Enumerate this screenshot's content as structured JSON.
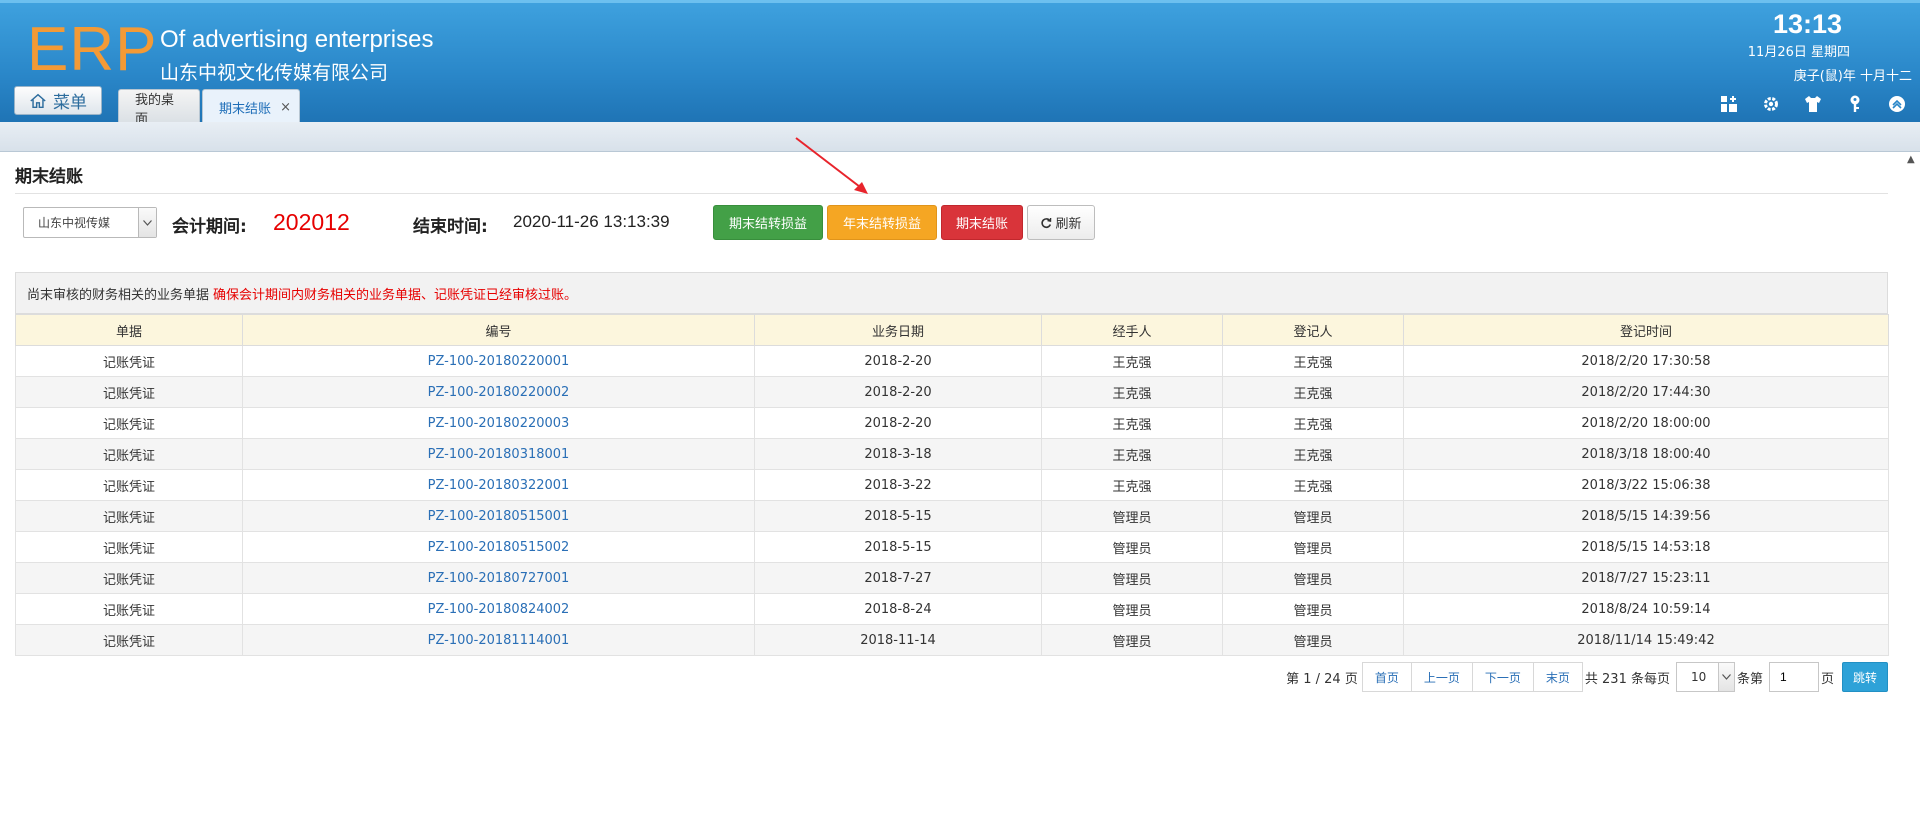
{
  "header": {
    "logo": "ERP",
    "brand_en": "Of advertising enterprises",
    "brand_cn": "山东中视文化传媒有限公司",
    "clock": "13:13",
    "date": "11月26日 星期四",
    "lunar": "庚子(鼠)年 十月十二",
    "menu_label": "菜单",
    "tabs": [
      {
        "label": "我的桌面"
      },
      {
        "label": "期末结账",
        "close": "×"
      }
    ],
    "tool_icons": [
      "add-widget-icon",
      "gear-icon",
      "shirt-icon",
      "key-icon",
      "collapse-icon"
    ]
  },
  "page": {
    "title": "期末结账",
    "company": "山东中视传媒",
    "period_label": "会计期间:",
    "period_value": "202012",
    "end_label": "结束时间:",
    "end_value": "2020-11-26 13:13:39",
    "buttons": {
      "period_transfer": "期末结转损益",
      "year_transfer": "年末结转损益",
      "close_period": "期末结账",
      "refresh": "刷新"
    },
    "notice_text": "尚末审核的财务相关的业务单据",
    "notice_warning": "确保会计期间内财务相关的业务单据、记账凭证已经审核过账。"
  },
  "table": {
    "headers": [
      "单据",
      "编号",
      "业务日期",
      "经手人",
      "登记人",
      "登记时间"
    ],
    "rows": [
      [
        "记账凭证",
        "PZ-100-20180220001",
        "2018-2-20",
        "王克强",
        "王克强",
        "2018/2/20 17:30:58"
      ],
      [
        "记账凭证",
        "PZ-100-20180220002",
        "2018-2-20",
        "王克强",
        "王克强",
        "2018/2/20 17:44:30"
      ],
      [
        "记账凭证",
        "PZ-100-20180220003",
        "2018-2-20",
        "王克强",
        "王克强",
        "2018/2/20 18:00:00"
      ],
      [
        "记账凭证",
        "PZ-100-20180318001",
        "2018-3-18",
        "王克强",
        "王克强",
        "2018/3/18 18:00:40"
      ],
      [
        "记账凭证",
        "PZ-100-20180322001",
        "2018-3-22",
        "王克强",
        "王克强",
        "2018/3/22 15:06:38"
      ],
      [
        "记账凭证",
        "PZ-100-20180515001",
        "2018-5-15",
        "管理员",
        "管理员",
        "2018/5/15 14:39:56"
      ],
      [
        "记账凭证",
        "PZ-100-20180515002",
        "2018-5-15",
        "管理员",
        "管理员",
        "2018/5/15 14:53:18"
      ],
      [
        "记账凭证",
        "PZ-100-20180727001",
        "2018-7-27",
        "管理员",
        "管理员",
        "2018/7/27 15:23:11"
      ],
      [
        "记账凭证",
        "PZ-100-20180824002",
        "2018-8-24",
        "管理员",
        "管理员",
        "2018/8/24 10:59:14"
      ],
      [
        "记账凭证",
        "PZ-100-20181114001",
        "2018-11-14",
        "管理员",
        "管理员",
        "2018/11/14 15:49:42"
      ]
    ]
  },
  "pager": {
    "page_info": "第 1 / 24 页",
    "first": "首页",
    "prev": "上一页",
    "next": "下一页",
    "last": "末页",
    "total": "共 231 条每页",
    "page_size": "10",
    "per_page_suffix": "条第",
    "page_input": "1",
    "page_suffix": "页",
    "go": "跳转"
  },
  "colors": {
    "header_blue": "#2a87c9",
    "logo_orange": "#f39a36",
    "green": "#43a047",
    "orange": "#f5a623",
    "red": "#d9343a",
    "link_blue": "#2a6fb6",
    "warning_red": "#e60000"
  }
}
